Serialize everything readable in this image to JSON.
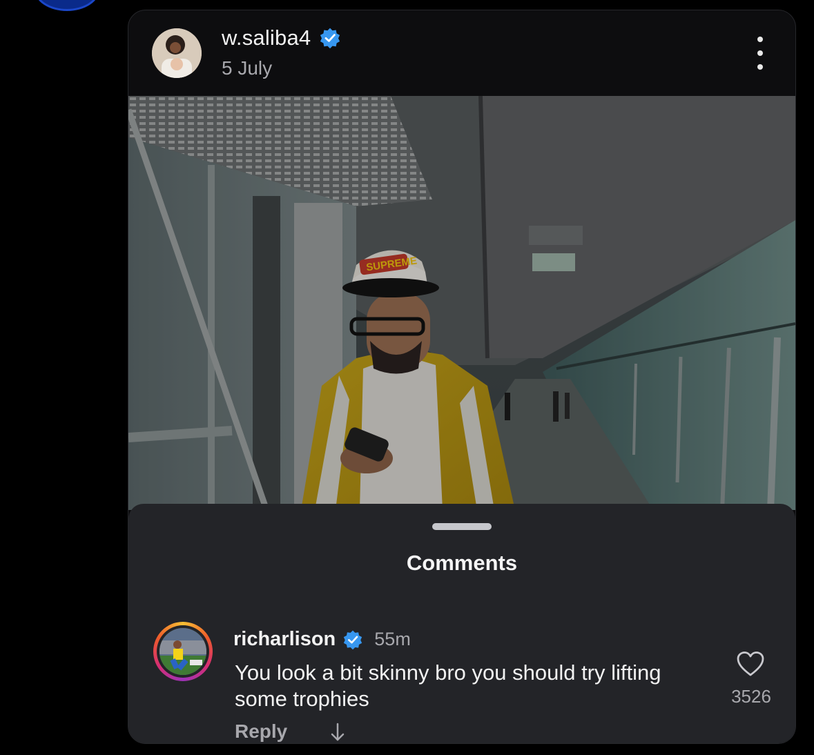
{
  "post": {
    "username": "w.saliba4",
    "date": "5 July",
    "verified": true
  },
  "photo": {
    "cap_text": "SUPREME"
  },
  "comments_sheet": {
    "title": "Comments",
    "items": [
      {
        "username": "richarlison",
        "verified": true,
        "time": "55m",
        "text": "You look a bit skinny bro you should try lifting some trophies",
        "reply_label": "Reply",
        "likes": "3526"
      }
    ]
  },
  "icons": {
    "verified": "verified-badge-icon",
    "more": "more-vertical-icon",
    "like": "heart-outline-icon",
    "arrow": "arrow-down-icon"
  },
  "colors": {
    "verified_blue": "#3797f0",
    "sheet_bg": "#232428",
    "card_bg": "#0d0d0f"
  }
}
